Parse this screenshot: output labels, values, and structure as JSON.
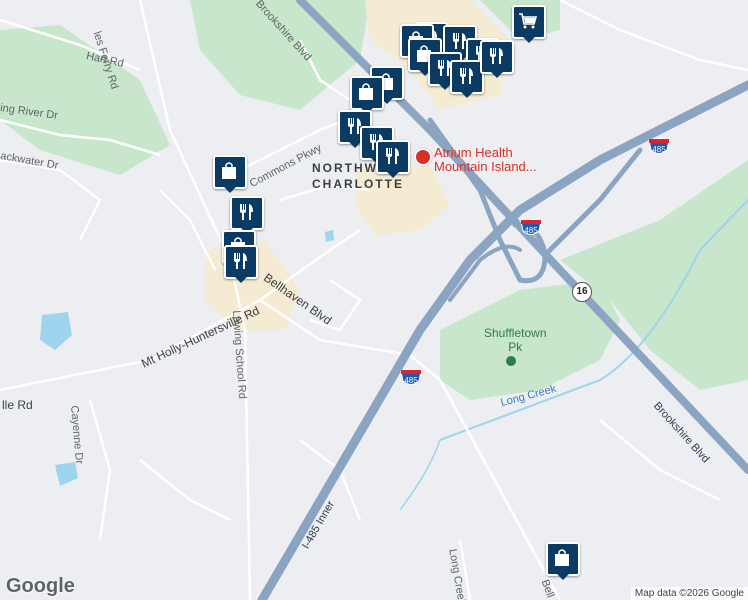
{
  "map": {
    "roads": {
      "brookshire_north": "Brookshire Blvd",
      "brookshire_south": "Brookshire Blvd",
      "i485_inner": "I-485 Inner",
      "mt_holly": "Mt Holly-Huntersville Rd",
      "bellhaven": "Bellhaven Blvd",
      "lawing_school": "Lawing School Rd",
      "hart": "Hart Rd",
      "oakdale_fragment": "lle Rd",
      "ferry": "les Ferry Rd",
      "spring_river": "ing River Dr",
      "blackwater": "ackwater Dr",
      "commons": "Commons Pkwy",
      "cayenne": "Cayenne Dr",
      "long_creek_rd": "Long Creek",
      "bell_fragment": "Bell"
    },
    "places": {
      "neighborhood": "NORTHWEST CHARLOTTE",
      "hospital_line1": "Atrium Health",
      "hospital_line2": "Mountain Island...",
      "park_line1": "Shuffletown",
      "park_line2": "Pk",
      "creek": "Long Creek"
    },
    "shields": {
      "interstate": "485",
      "state_route": "16"
    },
    "pins": [
      {
        "icon": "cart-icon"
      },
      {
        "icon": "restaurant-icon"
      },
      {
        "icon": "restaurant-icon"
      },
      {
        "icon": "restaurant-icon"
      },
      {
        "icon": "shopping-bag-icon"
      },
      {
        "icon": "shopping-bag-icon"
      },
      {
        "icon": "restaurant-icon"
      },
      {
        "icon": "restaurant-icon"
      },
      {
        "icon": "shopping-bag-icon"
      },
      {
        "icon": "shopping-bag-icon"
      },
      {
        "icon": "shopping-bag-icon"
      },
      {
        "icon": "restaurant-icon"
      },
      {
        "icon": "shopping-bag-icon"
      }
    ],
    "colors": {
      "land": "#eceef2",
      "park": "#c8e6cc",
      "highway": "#8aa4c1",
      "water": "#9fd4ee",
      "pin": "#0b3b63",
      "hospital": "#d93025"
    }
  },
  "footer": {
    "logo": "Google",
    "attribution": "Map data ©2026 Google"
  }
}
